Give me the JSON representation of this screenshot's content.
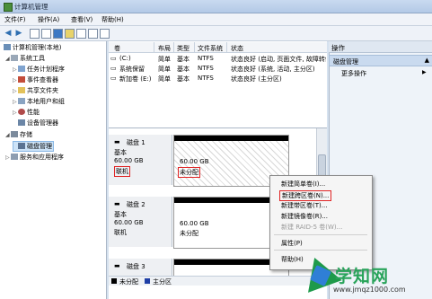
{
  "window": {
    "title": "计算机管理"
  },
  "menu": [
    "文件(F)",
    "操作(A)",
    "查看(V)",
    "帮助(H)"
  ],
  "tree": {
    "root": "计算机管理(本地)",
    "system_tools": "系统工具",
    "task_scheduler": "任务计划程序",
    "event_viewer": "事件查看器",
    "shared_folders": "共享文件夹",
    "local_users": "本地用户和组",
    "performance": "性能",
    "device_manager": "设备管理器",
    "storage": "存储",
    "disk_management": "磁盘管理",
    "services_apps": "服务和应用程序"
  },
  "volumes": {
    "headers": [
      "卷",
      "布局",
      "类型",
      "文件系统",
      "状态"
    ],
    "rows": [
      {
        "name": "(C:)",
        "layout": "简单",
        "type": "基本",
        "fs": "NTFS",
        "status": "状态良好 (启动, 页面文件, 故障转储, 主分区)"
      },
      {
        "name": "系统保留",
        "layout": "简单",
        "type": "基本",
        "fs": "NTFS",
        "status": "状态良好 (系统, 活动, 主分区)"
      },
      {
        "name": "新加卷 (E:)",
        "layout": "简单",
        "type": "基本",
        "fs": "NTFS",
        "status": "状态良好 (主分区)"
      }
    ]
  },
  "disks": [
    {
      "name": "磁盘 1",
      "type": "基本",
      "size": "60.00 GB",
      "status": "联机",
      "part_size": "60.00 GB",
      "part_status": "未分配"
    },
    {
      "name": "磁盘 2",
      "type": "基本",
      "size": "60.00 GB",
      "status": "联机",
      "part_size": "60.00 GB",
      "part_status": "未分配"
    },
    {
      "name": "磁盘 3",
      "type": "",
      "size": "",
      "status": "",
      "part_size": "",
      "part_status": ""
    }
  ],
  "legend": {
    "unallocated": "未分配",
    "primary": "主分区"
  },
  "actions": {
    "title": "操作",
    "section": "磁盘管理",
    "more": "更多操作"
  },
  "context_menu": [
    "新建简单卷(I)...",
    "新建跨区卷(N)...",
    "新建带区卷(T)...",
    "新建镜像卷(R)...",
    "新建 RAID-5 卷(W)...",
    "属性(P)",
    "帮助(H)"
  ],
  "watermark": {
    "text": "学知网",
    "url": "www.jmqz1000.com"
  }
}
